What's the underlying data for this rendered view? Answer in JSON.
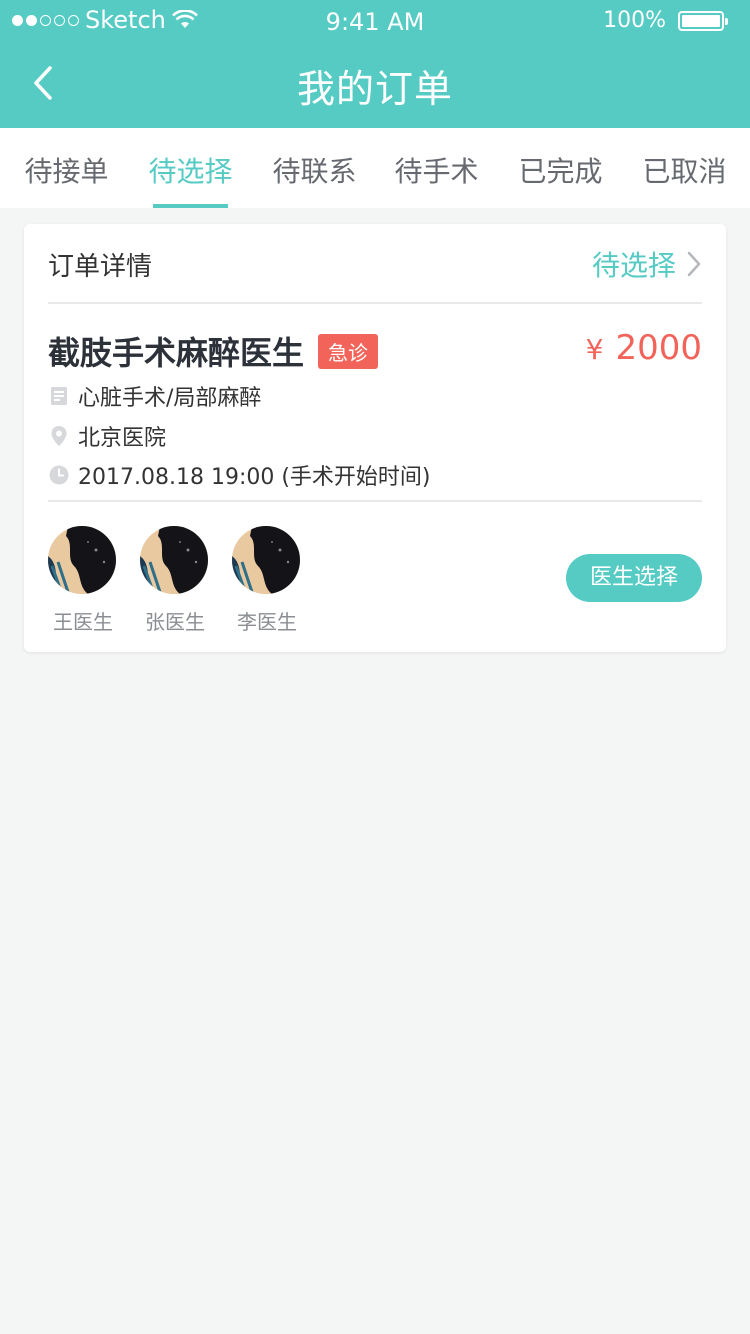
{
  "status_bar": {
    "carrier": "Sketch",
    "time": "9:41 AM",
    "battery": "100%"
  },
  "header": {
    "title": "我的订单"
  },
  "tabs": [
    {
      "label": "待接单"
    },
    {
      "label": "待选择",
      "active": true
    },
    {
      "label": "待联系"
    },
    {
      "label": "待手术"
    },
    {
      "label": "已完成"
    },
    {
      "label": "已取消"
    }
  ],
  "order": {
    "head_title": "订单详情",
    "head_status": "待选择",
    "title": "截肢手术麻醉医生",
    "badge": "急诊",
    "currency": "¥",
    "price": "2000",
    "surgery": "心脏手术/局部麻醉",
    "hospital": "北京医院",
    "time": "2017.08.18 19:00 (手术开始时间)",
    "doctors": [
      {
        "name": "王医生"
      },
      {
        "name": "张医生"
      },
      {
        "name": "李医生"
      }
    ],
    "select_button": "医生选择"
  },
  "colors": {
    "accent": "#55cbc4",
    "price": "#f2645a",
    "background": "#f4f5f5"
  }
}
